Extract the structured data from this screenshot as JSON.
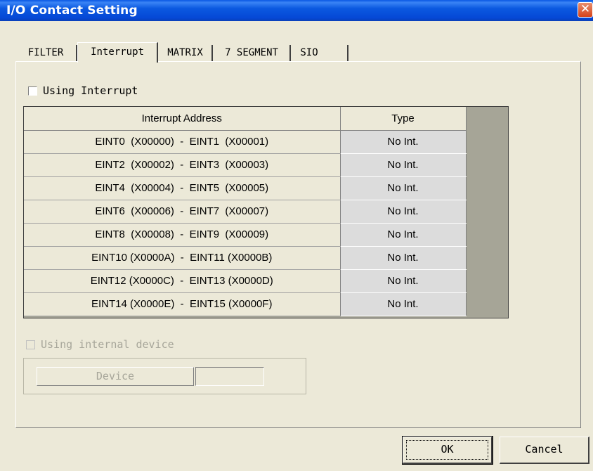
{
  "window": {
    "title": "I/O Contact Setting",
    "close_glyph": "✕"
  },
  "tabs": [
    {
      "label": "FILTER",
      "active": false
    },
    {
      "label": "Interrupt",
      "active": true
    },
    {
      "label": "MATRIX",
      "active": false
    },
    {
      "label": "7 SEGMENT",
      "active": false
    },
    {
      "label": "SIO",
      "active": false
    }
  ],
  "interrupt": {
    "use_label": "Using Interrupt",
    "use_checked": false,
    "columns": {
      "address": "Interrupt Address",
      "type": "Type"
    },
    "rows": [
      {
        "address": "EINT0  (X00000)  -  EINT1  (X00001)",
        "type": "No Int."
      },
      {
        "address": "EINT2  (X00002)  -  EINT3  (X00003)",
        "type": "No Int."
      },
      {
        "address": "EINT4  (X00004)  -  EINT5  (X00005)",
        "type": "No Int."
      },
      {
        "address": "EINT6  (X00006)  -  EINT7  (X00007)",
        "type": "No Int."
      },
      {
        "address": "EINT8  (X00008)  -  EINT9  (X00009)",
        "type": "No Int."
      },
      {
        "address": "EINT10 (X0000A)  -  EINT11 (X0000B)",
        "type": "No Int."
      },
      {
        "address": "EINT12 (X0000C)  -  EINT13 (X0000D)",
        "type": "No Int."
      },
      {
        "address": "EINT14 (X0000E)  -  EINT15 (X0000F)",
        "type": "No Int."
      }
    ]
  },
  "internal_device": {
    "label": "Using internal device",
    "checked": false,
    "enabled": false,
    "device_button": "Device",
    "device_value": ""
  },
  "buttons": {
    "ok": "OK",
    "cancel": "Cancel"
  },
  "colors": {
    "titlebar": "#0548d6",
    "face": "#ece9d8",
    "type_cell": "#dcdcdc",
    "disabled_text": "#a7a69a"
  }
}
